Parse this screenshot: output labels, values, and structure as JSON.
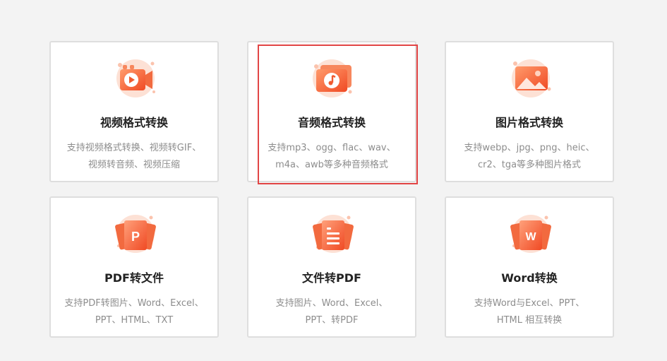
{
  "accent_color": "#f2673a",
  "selection_color": "#e24545",
  "cards": [
    {
      "title": "视频格式转换",
      "icon": "video-camera-icon",
      "desc_line1": "支持视频格式转换、视频转GIF、",
      "desc_line2": "视频转音频、视频压缩",
      "selected": false
    },
    {
      "title": "音频格式转换",
      "icon": "music-note-icon",
      "desc_line1": "支持mp3、ogg、flac、wav、",
      "desc_line2": "m4a、awb等多种音频格式",
      "selected": true
    },
    {
      "title": "图片格式转换",
      "icon": "picture-icon",
      "desc_line1": "支持webp、jpg、png、heic、",
      "desc_line2": "cr2、tga等多种图片格式",
      "selected": false
    },
    {
      "title": "PDF转文件",
      "icon": "pdf-file-icon",
      "icon_letter": "P",
      "desc_line1": "支持PDF转图片、Word、Excel、",
      "desc_line2": "PPT、HTML、TXT",
      "selected": false
    },
    {
      "title": "文件转PDF",
      "icon": "document-icon",
      "desc_line1": "支持图片、Word、Excel、",
      "desc_line2": "PPT、转PDF",
      "selected": false
    },
    {
      "title": "Word转换",
      "icon": "word-file-icon",
      "icon_letter": "W",
      "desc_line1": "支持Word与Excel、PPT、",
      "desc_line2": "HTML 相互转换",
      "selected": false
    }
  ]
}
